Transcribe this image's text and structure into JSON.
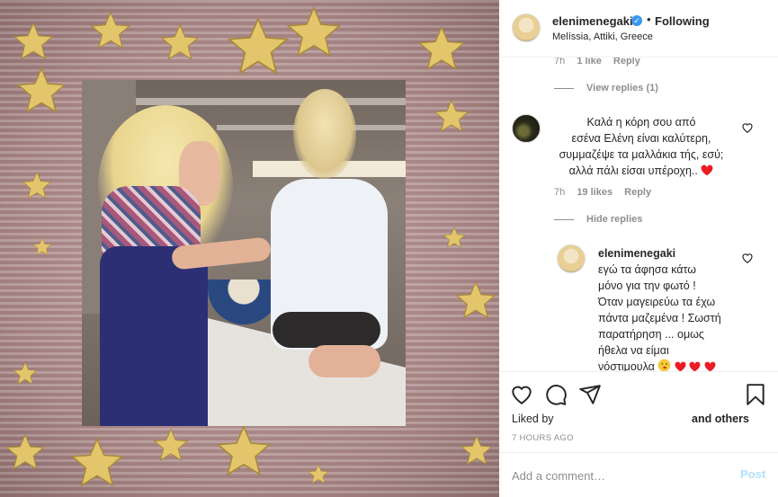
{
  "post": {
    "username": "elenimenegaki",
    "follow_status": "Following",
    "location": "Melíssia, Attiki, Greece",
    "verified_icon": "verified-badge-icon"
  },
  "comments": {
    "top_meta": {
      "time": "7h",
      "likes": "1 like",
      "reply": "Reply"
    },
    "view_replies": "View replies (1)",
    "comment": {
      "lines": [
        "Καλά η κόρη σου από",
        "εσένα Ελένη είναι καλύτερη,",
        "συμμαζέψε τα μαλλάκια τής, εσύ;",
        "αλλά πάλι είσαι υπέροχη.."
      ],
      "time": "7h",
      "likes": "19 likes",
      "reply": "Reply"
    },
    "hide_replies": "Hide replies",
    "reply": {
      "username": "elenimenegaki",
      "lines": [
        "εγώ τα άφησα κάτω",
        "μόνο για την φωτό !",
        "Όταν μαγειρεύω τα έχω",
        "πάντα μαζεμένα ! Σωστή",
        "παρατήρηση ... ομως",
        "ήθελα να είμαι",
        "νόστιμουλα"
      ]
    }
  },
  "actions": {
    "liked_by": "Liked by",
    "and_others": "and others",
    "time_ago": "7 HOURS AGO"
  },
  "add_comment": {
    "placeholder": "Add a comment…",
    "post_label": "Post"
  },
  "colors": {
    "verified": "#3897f0",
    "post_disabled": "#b2dffc",
    "heart_red": "#ed1c24",
    "muted_text": "#8e8e8e"
  },
  "icons": [
    "heart-icon",
    "comment-icon",
    "share-icon",
    "bookmark-icon",
    "star-icon"
  ]
}
